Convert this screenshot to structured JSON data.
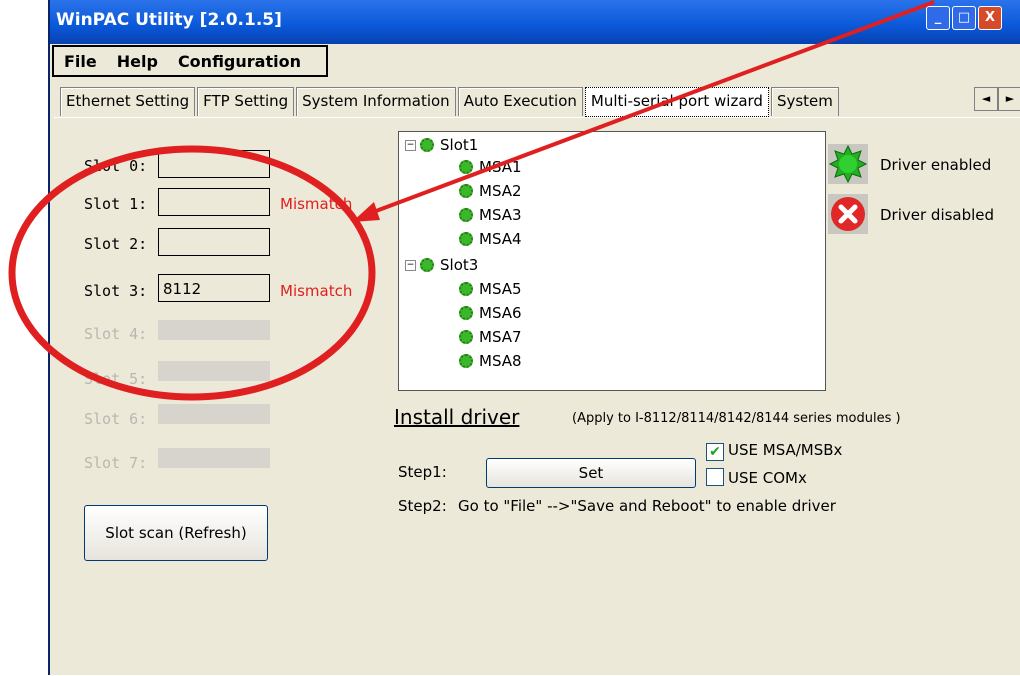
{
  "window": {
    "title": "WinPAC Utility [2.0.1.5]",
    "controls": [
      "_",
      "□",
      "X"
    ]
  },
  "menu": [
    "File",
    "Help",
    "Configuration"
  ],
  "tabs": [
    "Ethernet Setting",
    "FTP Setting",
    "System Information",
    "Auto Execution",
    "Multi-serial port wizard",
    "System"
  ],
  "tab_arrows": [
    "◄",
    "►"
  ],
  "slots": [
    {
      "label": "Slot 0:",
      "value": "",
      "status": "",
      "enabled": true
    },
    {
      "label": "Slot 1:",
      "value": "",
      "status": "Mismatch",
      "enabled": true
    },
    {
      "label": "Slot 2:",
      "value": "",
      "status": "",
      "enabled": true
    },
    {
      "label": "Slot 3:",
      "value": "8112",
      "status": "Mismatch",
      "enabled": true
    },
    {
      "label": "Slot 4:",
      "value": "",
      "status": "",
      "enabled": false
    },
    {
      "label": "Slot 5:",
      "value": "",
      "status": "",
      "enabled": false
    },
    {
      "label": "Slot 6:",
      "value": "",
      "status": "",
      "enabled": false
    },
    {
      "label": "Slot 7:",
      "value": "",
      "status": "",
      "enabled": false
    }
  ],
  "tree": [
    {
      "label": "Slot1",
      "children": [
        "MSA1",
        "MSA2",
        "MSA3",
        "MSA4"
      ]
    },
    {
      "label": "Slot3",
      "children": [
        "MSA5",
        "MSA6",
        "MSA7",
        "MSA8"
      ]
    }
  ],
  "legend": {
    "enabled": "Driver enabled",
    "disabled": "Driver disabled"
  },
  "install": {
    "title": "Install driver",
    "note": "(Apply to I-8112/8114/8142/8144 series modules )",
    "step1_label": "Step1:",
    "set_label": "Set",
    "use_msa_label": "USE MSA/MSBx",
    "use_msa_checked": true,
    "use_com_label": "USE COMx",
    "use_com_checked": false,
    "step2_label": "Step2:",
    "step2_text": "Go to \"File\" -->\"Save and Reboot\" to enable driver"
  },
  "scan_button": "Slot scan (Refresh)",
  "colors": {
    "mismatch": "#e02020",
    "annotation": "#e02020",
    "title_bar": "#0a58d8"
  }
}
